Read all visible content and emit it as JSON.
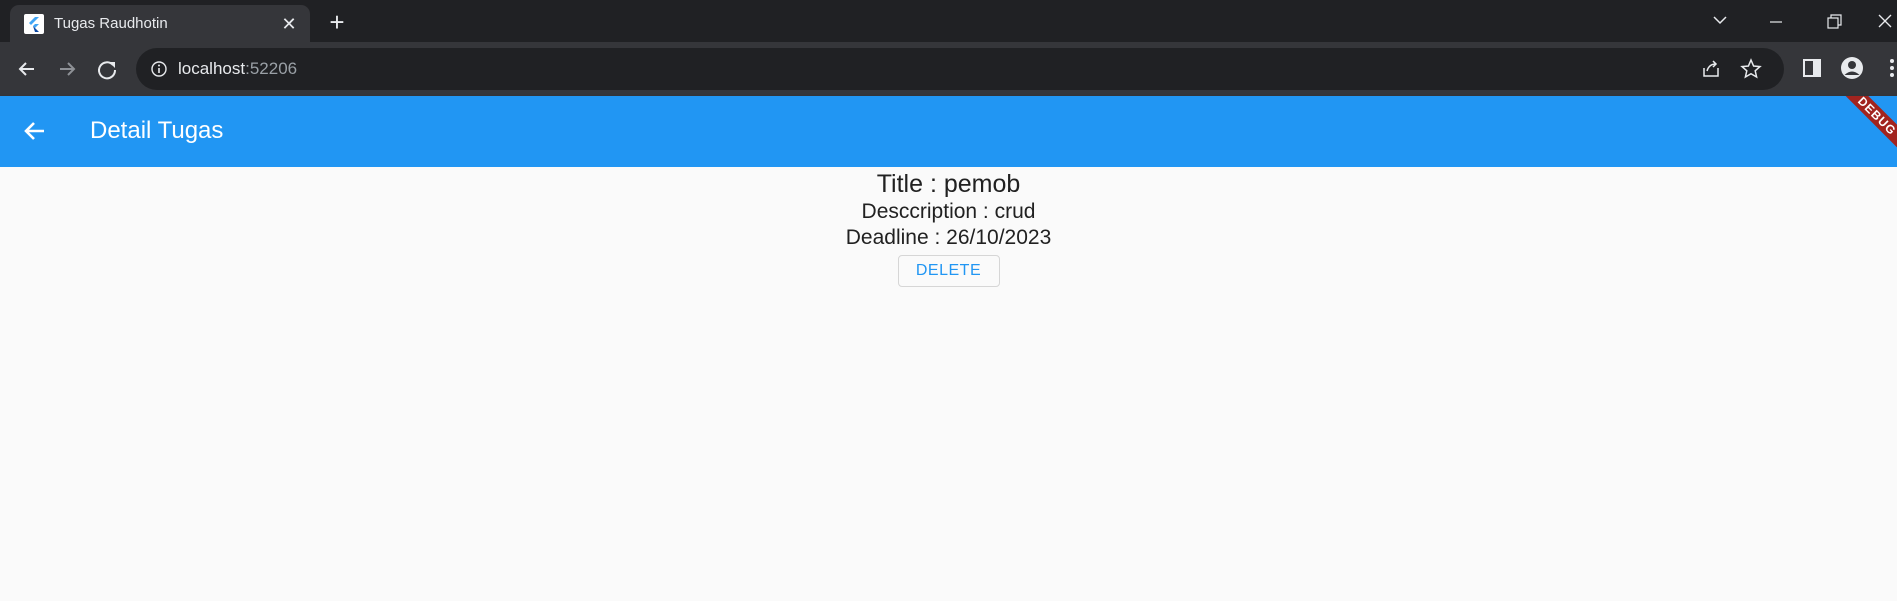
{
  "browser": {
    "tab": {
      "title": "Tugas Raudhotin",
      "close_symbol": "✕"
    },
    "new_tab_symbol": "+",
    "address": {
      "host": "localhost",
      "port": ":52206"
    }
  },
  "app": {
    "title": "Detail Tugas",
    "debug_banner": "DEBUG",
    "accent_color": "#2196f3",
    "task": {
      "title_line": "Title : pemob",
      "description_line": "Desccription : crud",
      "deadline_line": "Deadline :  26/10/2023"
    },
    "delete_label": "DELETE"
  }
}
